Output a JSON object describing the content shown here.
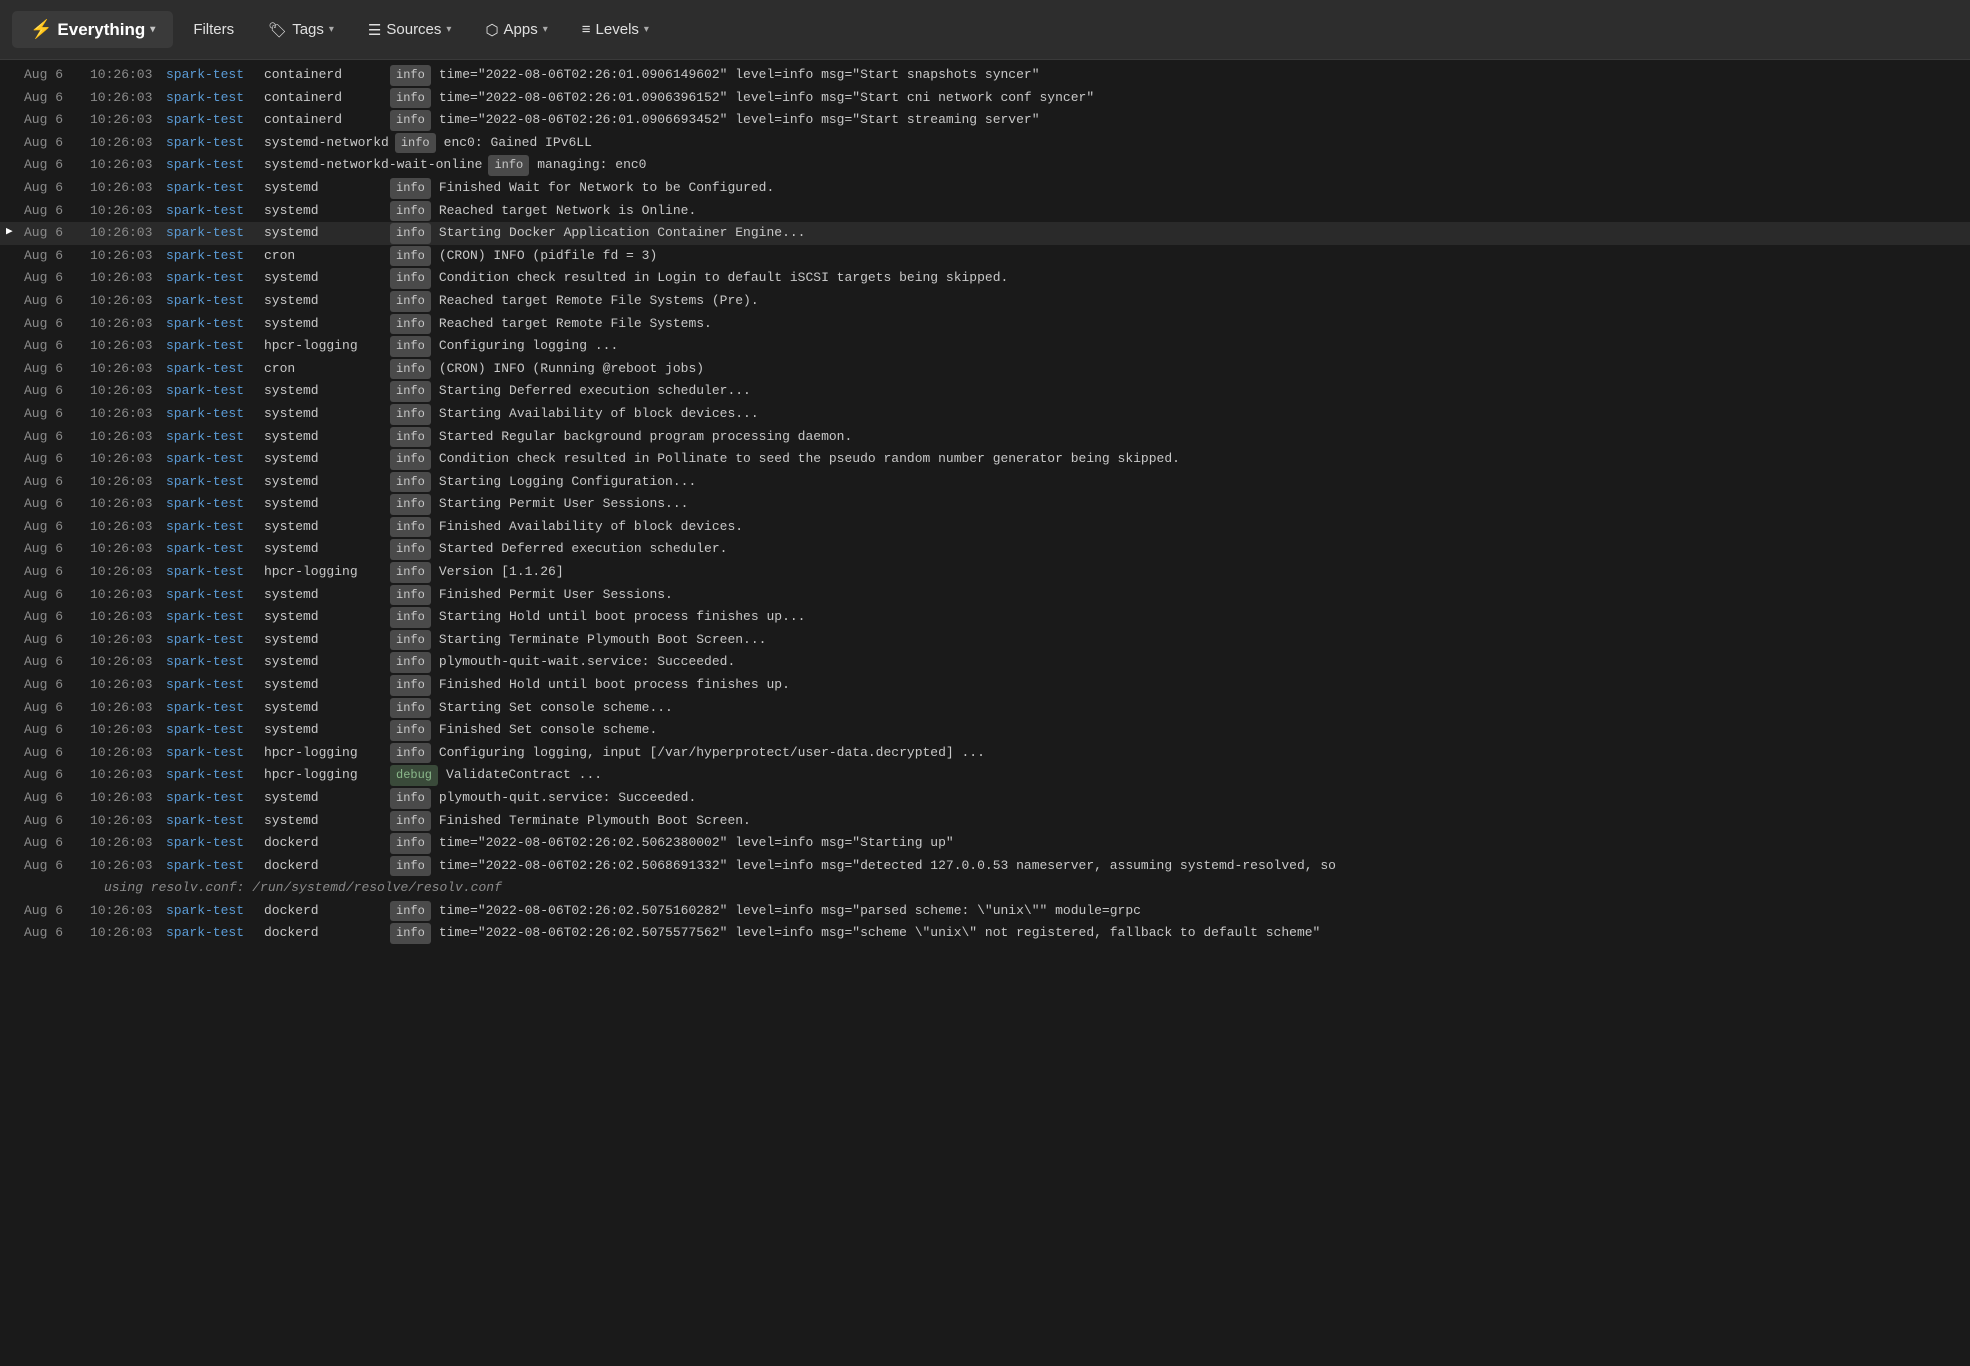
{
  "toolbar": {
    "everything_label": "Everything",
    "bolt_icon": "⚡",
    "chevron": "▾",
    "filters_label": "Filters",
    "tags_label": "Tags",
    "tag_icon": "🏷",
    "sources_label": "Sources",
    "sources_icon": "☰",
    "apps_label": "Apps",
    "apps_icon": "⬡",
    "levels_label": "Levels",
    "levels_icon": "≡"
  },
  "logs": [
    {
      "date": "Aug 6",
      "time": "10:26:03",
      "host": "spark-test",
      "service": "containerd",
      "level": "info",
      "message": "time=\"2022-08-06T02:26:01.0906149602\" level=info msg=\"Start snapshots syncer\"",
      "highlighted": false,
      "arrow": false,
      "continuation": false
    },
    {
      "date": "Aug 6",
      "time": "10:26:03",
      "host": "spark-test",
      "service": "containerd",
      "level": "info",
      "message": "time=\"2022-08-06T02:26:01.0906396152\" level=info msg=\"Start cni network conf syncer\"",
      "highlighted": false,
      "arrow": false,
      "continuation": false
    },
    {
      "date": "Aug 6",
      "time": "10:26:03",
      "host": "spark-test",
      "service": "containerd",
      "level": "info",
      "message": "time=\"2022-08-06T02:26:01.0906693452\" level=info msg=\"Start streaming server\"",
      "highlighted": false,
      "arrow": false,
      "continuation": false
    },
    {
      "date": "Aug 6",
      "time": "10:26:03",
      "host": "spark-test",
      "service": "systemd-networkd",
      "level": "info",
      "message": "enc0: Gained IPv6LL",
      "highlighted": false,
      "arrow": false,
      "continuation": false
    },
    {
      "date": "Aug 6",
      "time": "10:26:03",
      "host": "spark-test",
      "service": "systemd-networkd-wait-online",
      "level": "info",
      "message": "managing: enc0",
      "highlighted": false,
      "arrow": false,
      "continuation": false
    },
    {
      "date": "Aug 6",
      "time": "10:26:03",
      "host": "spark-test",
      "service": "systemd",
      "level": "info",
      "message": "Finished Wait for Network to be Configured.",
      "highlighted": false,
      "arrow": false,
      "continuation": false
    },
    {
      "date": "Aug 6",
      "time": "10:26:03",
      "host": "spark-test",
      "service": "systemd",
      "level": "info",
      "message": "Reached target Network is Online.",
      "highlighted": false,
      "arrow": false,
      "continuation": false
    },
    {
      "date": "Aug 6",
      "time": "10:26:03",
      "host": "spark-test",
      "service": "systemd",
      "level": "info",
      "message": "Starting Docker Application Container Engine...",
      "highlighted": true,
      "arrow": true,
      "continuation": false
    },
    {
      "date": "Aug 6",
      "time": "10:26:03",
      "host": "spark-test",
      "service": "cron",
      "level": "info",
      "message": "(CRON) INFO (pidfile fd = 3)",
      "highlighted": false,
      "arrow": false,
      "continuation": false
    },
    {
      "date": "Aug 6",
      "time": "10:26:03",
      "host": "spark-test",
      "service": "systemd",
      "level": "info",
      "message": "Condition check resulted in Login to default iSCSI targets being skipped.",
      "highlighted": false,
      "arrow": false,
      "continuation": false
    },
    {
      "date": "Aug 6",
      "time": "10:26:03",
      "host": "spark-test",
      "service": "systemd",
      "level": "info",
      "message": "Reached target Remote File Systems (Pre).",
      "highlighted": false,
      "arrow": false,
      "continuation": false
    },
    {
      "date": "Aug 6",
      "time": "10:26:03",
      "host": "spark-test",
      "service": "systemd",
      "level": "info",
      "message": "Reached target Remote File Systems.",
      "highlighted": false,
      "arrow": false,
      "continuation": false
    },
    {
      "date": "Aug 6",
      "time": "10:26:03",
      "host": "spark-test",
      "service": "hpcr-logging",
      "level": "info",
      "message": "Configuring logging ...",
      "highlighted": false,
      "arrow": false,
      "continuation": false
    },
    {
      "date": "Aug 6",
      "time": "10:26:03",
      "host": "spark-test",
      "service": "cron",
      "level": "info",
      "message": "(CRON) INFO (Running @reboot jobs)",
      "highlighted": false,
      "arrow": false,
      "continuation": false
    },
    {
      "date": "Aug 6",
      "time": "10:26:03",
      "host": "spark-test",
      "service": "systemd",
      "level": "info",
      "message": "Starting Deferred execution scheduler...",
      "highlighted": false,
      "arrow": false,
      "continuation": false
    },
    {
      "date": "Aug 6",
      "time": "10:26:03",
      "host": "spark-test",
      "service": "systemd",
      "level": "info",
      "message": "Starting Availability of block devices...",
      "highlighted": false,
      "arrow": false,
      "continuation": false
    },
    {
      "date": "Aug 6",
      "time": "10:26:03",
      "host": "spark-test",
      "service": "systemd",
      "level": "info",
      "message": "Started Regular background program processing daemon.",
      "highlighted": false,
      "arrow": false,
      "continuation": false
    },
    {
      "date": "Aug 6",
      "time": "10:26:03",
      "host": "spark-test",
      "service": "systemd",
      "level": "info",
      "message": "Condition check resulted in Pollinate to seed the pseudo random number generator being skipped.",
      "highlighted": false,
      "arrow": false,
      "continuation": false
    },
    {
      "date": "Aug 6",
      "time": "10:26:03",
      "host": "spark-test",
      "service": "systemd",
      "level": "info",
      "message": "Starting Logging Configuration...",
      "highlighted": false,
      "arrow": false,
      "continuation": false
    },
    {
      "date": "Aug 6",
      "time": "10:26:03",
      "host": "spark-test",
      "service": "systemd",
      "level": "info",
      "message": "Starting Permit User Sessions...",
      "highlighted": false,
      "arrow": false,
      "continuation": false
    },
    {
      "date": "Aug 6",
      "time": "10:26:03",
      "host": "spark-test",
      "service": "systemd",
      "level": "info",
      "message": "Finished Availability of block devices.",
      "highlighted": false,
      "arrow": false,
      "continuation": false
    },
    {
      "date": "Aug 6",
      "time": "10:26:03",
      "host": "spark-test",
      "service": "systemd",
      "level": "info",
      "message": "Started Deferred execution scheduler.",
      "highlighted": false,
      "arrow": false,
      "continuation": false
    },
    {
      "date": "Aug 6",
      "time": "10:26:03",
      "host": "spark-test",
      "service": "hpcr-logging",
      "level": "info",
      "message": "Version [1.1.26]",
      "highlighted": false,
      "arrow": false,
      "continuation": false
    },
    {
      "date": "Aug 6",
      "time": "10:26:03",
      "host": "spark-test",
      "service": "systemd",
      "level": "info",
      "message": "Finished Permit User Sessions.",
      "highlighted": false,
      "arrow": false,
      "continuation": false
    },
    {
      "date": "Aug 6",
      "time": "10:26:03",
      "host": "spark-test",
      "service": "systemd",
      "level": "info",
      "message": "Starting Hold until boot process finishes up...",
      "highlighted": false,
      "arrow": false,
      "continuation": false
    },
    {
      "date": "Aug 6",
      "time": "10:26:03",
      "host": "spark-test",
      "service": "systemd",
      "level": "info",
      "message": "Starting Terminate Plymouth Boot Screen...",
      "highlighted": false,
      "arrow": false,
      "continuation": false
    },
    {
      "date": "Aug 6",
      "time": "10:26:03",
      "host": "spark-test",
      "service": "systemd",
      "level": "info",
      "message": "plymouth-quit-wait.service: Succeeded.",
      "highlighted": false,
      "arrow": false,
      "continuation": false
    },
    {
      "date": "Aug 6",
      "time": "10:26:03",
      "host": "spark-test",
      "service": "systemd",
      "level": "info",
      "message": "Finished Hold until boot process finishes up.",
      "highlighted": false,
      "arrow": false,
      "continuation": false
    },
    {
      "date": "Aug 6",
      "time": "10:26:03",
      "host": "spark-test",
      "service": "systemd",
      "level": "info",
      "message": "Starting Set console scheme...",
      "highlighted": false,
      "arrow": false,
      "continuation": false
    },
    {
      "date": "Aug 6",
      "time": "10:26:03",
      "host": "spark-test",
      "service": "systemd",
      "level": "info",
      "message": "Finished Set console scheme.",
      "highlighted": false,
      "arrow": false,
      "continuation": false
    },
    {
      "date": "Aug 6",
      "time": "10:26:03",
      "host": "spark-test",
      "service": "hpcr-logging",
      "level": "info",
      "message": "Configuring logging, input [/var/hyperprotect/user-data.decrypted] ...",
      "highlighted": false,
      "arrow": false,
      "continuation": false
    },
    {
      "date": "Aug 6",
      "time": "10:26:03",
      "host": "spark-test",
      "service": "hpcr-logging",
      "level": "debug",
      "message": "ValidateContract ...",
      "highlighted": false,
      "arrow": false,
      "continuation": false
    },
    {
      "date": "Aug 6",
      "time": "10:26:03",
      "host": "spark-test",
      "service": "systemd",
      "level": "info",
      "message": "plymouth-quit.service: Succeeded.",
      "highlighted": false,
      "arrow": false,
      "continuation": false
    },
    {
      "date": "Aug 6",
      "time": "10:26:03",
      "host": "spark-test",
      "service": "systemd",
      "level": "info",
      "message": "Finished Terminate Plymouth Boot Screen.",
      "highlighted": false,
      "arrow": false,
      "continuation": false
    },
    {
      "date": "Aug 6",
      "time": "10:26:03",
      "host": "spark-test",
      "service": "dockerd",
      "level": "info",
      "message": "time=\"2022-08-06T02:26:02.5062380002\" level=info msg=\"Starting up\"",
      "highlighted": false,
      "arrow": false,
      "continuation": false
    },
    {
      "date": "Aug 6",
      "time": "10:26:03",
      "host": "spark-test",
      "service": "dockerd",
      "level": "info",
      "message": "time=\"2022-08-06T02:26:02.5068691332\" level=info msg=\"detected 127.0.0.53 nameserver, assuming systemd-resolved, so",
      "highlighted": false,
      "arrow": false,
      "continuation": true
    },
    {
      "date": "",
      "time": "",
      "host": "",
      "service": "",
      "level": "",
      "message": "using resolv.conf: /run/systemd/resolve/resolv.conf",
      "highlighted": false,
      "arrow": false,
      "continuation": true,
      "contonly": true
    },
    {
      "date": "Aug 6",
      "time": "10:26:03",
      "host": "spark-test",
      "service": "dockerd",
      "level": "info",
      "message": "time=\"2022-08-06T02:26:02.5075160282\" level=info msg=\"parsed scheme: \\\"unix\\\"\" module=grpc",
      "highlighted": false,
      "arrow": false,
      "continuation": false
    },
    {
      "date": "Aug 6",
      "time": "10:26:03",
      "host": "spark-test",
      "service": "dockerd",
      "level": "info",
      "message": "time=\"2022-08-06T02:26:02.5075577562\" level=info msg=\"scheme \\\"unix\\\" not registered, fallback to default scheme\"",
      "highlighted": false,
      "arrow": false,
      "continuation": false
    }
  ]
}
